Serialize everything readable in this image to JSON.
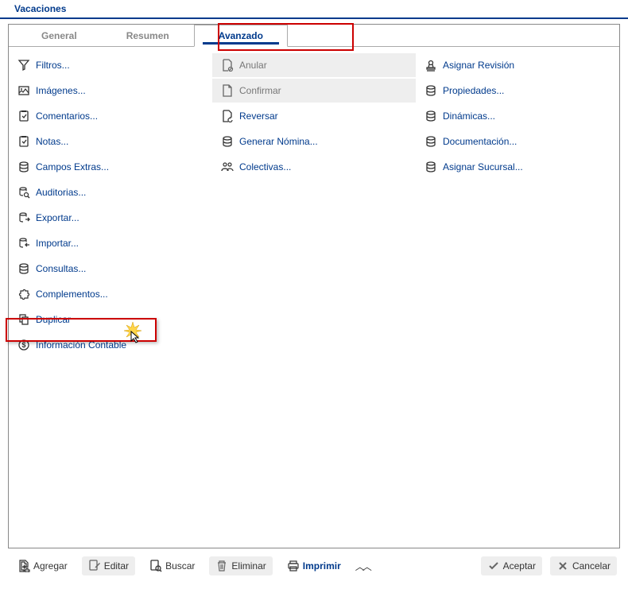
{
  "header": {
    "title": "Vacaciones"
  },
  "tabs": {
    "items": [
      "General",
      "Resumen",
      "Avanzado"
    ],
    "active": 2
  },
  "columns": [
    [
      {
        "id": "filtros",
        "label": "Filtros...",
        "icon": "funnel-icon"
      },
      {
        "id": "imagenes",
        "label": "Imágenes...",
        "icon": "image-icon"
      },
      {
        "id": "comentarios",
        "label": "Comentarios...",
        "icon": "clipboard-icon"
      },
      {
        "id": "notas",
        "label": "Notas...",
        "icon": "clipboard-icon"
      },
      {
        "id": "campos-extras",
        "label": "Campos Extras...",
        "icon": "db-icon"
      },
      {
        "id": "auditorias",
        "label": "Auditorias...",
        "icon": "db-search-icon"
      },
      {
        "id": "exportar",
        "label": "Exportar...",
        "icon": "db-export-icon"
      },
      {
        "id": "importar",
        "label": "Importar...",
        "icon": "db-import-icon"
      },
      {
        "id": "consultas",
        "label": "Consultas...",
        "icon": "db-icon"
      },
      {
        "id": "complementos",
        "label": "Complementos...",
        "icon": "puzzle-icon"
      },
      {
        "id": "duplicar",
        "label": "Duplicar",
        "icon": "copy-icon",
        "highlight": true
      },
      {
        "id": "info-contable",
        "label": "Información Contable",
        "icon": "dollar-icon"
      }
    ],
    [
      {
        "id": "anular",
        "label": "Anular",
        "icon": "doc-cancel-icon",
        "disabled": true
      },
      {
        "id": "confirmar",
        "label": "Confirmar",
        "icon": "doc-icon",
        "disabled": true
      },
      {
        "id": "reversar",
        "label": "Reversar",
        "icon": "doc-reverse-icon"
      },
      {
        "id": "generar-nomina",
        "label": "Generar Nómina...",
        "icon": "db-icon"
      },
      {
        "id": "colectivas",
        "label": "Colectivas...",
        "icon": "people-icon"
      }
    ],
    [
      {
        "id": "asignar-revision",
        "label": "Asignar Revisión",
        "icon": "stamp-icon"
      },
      {
        "id": "propiedades",
        "label": "Propiedades...",
        "icon": "db-icon"
      },
      {
        "id": "dinamicas",
        "label": "Dinámicas...",
        "icon": "db-icon"
      },
      {
        "id": "documentacion",
        "label": "Documentación...",
        "icon": "db-icon"
      },
      {
        "id": "asignar-sucursal",
        "label": "Asignar Sucursal...",
        "icon": "db-icon"
      }
    ]
  ],
  "footer": {
    "agregar": "Agregar",
    "editar": "Editar",
    "buscar": "Buscar",
    "eliminar": "Eliminar",
    "imprimir": "Imprimir",
    "aceptar": "Aceptar",
    "cancelar": "Cancelar"
  }
}
